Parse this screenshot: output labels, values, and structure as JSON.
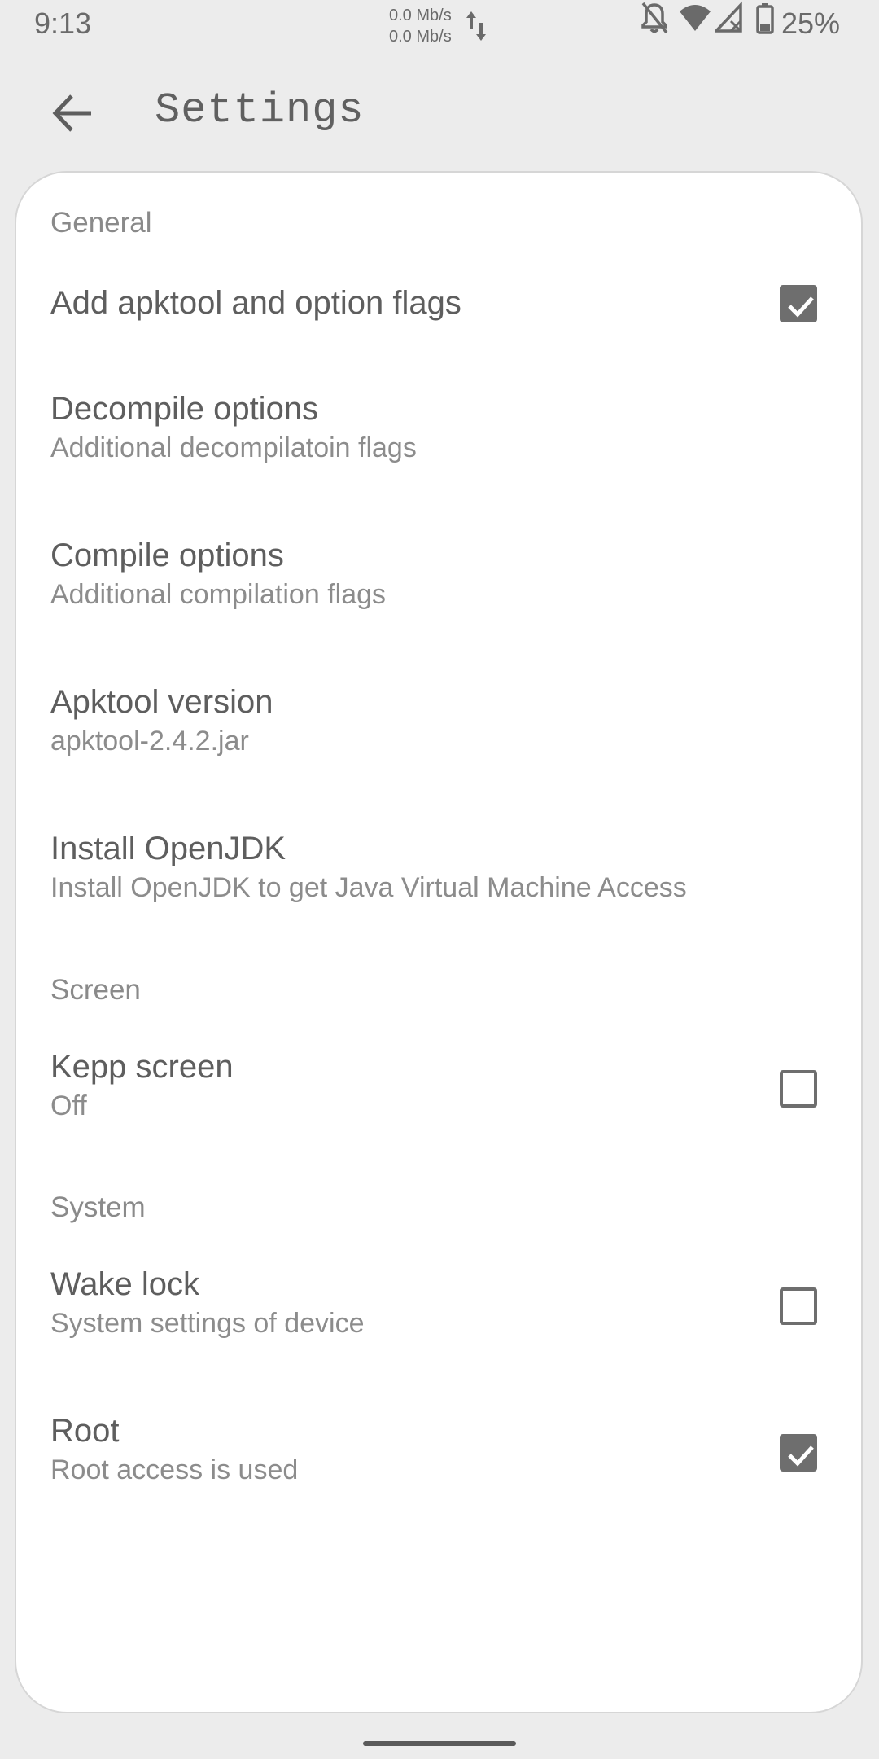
{
  "status_bar": {
    "time": "9:13",
    "net_up": "0.0 Mb/s",
    "net_down": "0.0 Mb/s",
    "icons": [
      "data-transfer-icon",
      "notifications-off-icon",
      "wifi-icon",
      "cellular-no-signal-icon",
      "battery-icon"
    ],
    "battery": "25%"
  },
  "app_bar": {
    "title": "Settings"
  },
  "sections": {
    "general": {
      "header": "General",
      "add_flags": {
        "title": "Add apktool and option flags",
        "checked": true
      },
      "decompile": {
        "title": "Decompile options",
        "summary": "Additional decompilatoin flags"
      },
      "compile": {
        "title": "Compile options",
        "summary": "Additional compilation flags"
      },
      "apktool_version": {
        "title": "Apktool version",
        "summary": "apktool-2.4.2.jar"
      },
      "openjdk": {
        "title": "Install OpenJDK",
        "summary": "Install OpenJDK to get Java Virtual Machine Access"
      }
    },
    "screen": {
      "header": "Screen",
      "keep_screen": {
        "title": "Kepp screen",
        "summary": "Off",
        "checked": false
      }
    },
    "system": {
      "header": "System",
      "wake_lock": {
        "title": "Wake lock",
        "summary": "System settings of device",
        "checked": false
      },
      "root": {
        "title": "Root",
        "summary": "Root access is used",
        "checked": true
      }
    }
  },
  "colors": {
    "background": "#ececec",
    "card": "#ffffff",
    "checkbox": "#6e6e6e",
    "text_primary": "#5e5e5e",
    "text_secondary": "#8c8c8c"
  }
}
